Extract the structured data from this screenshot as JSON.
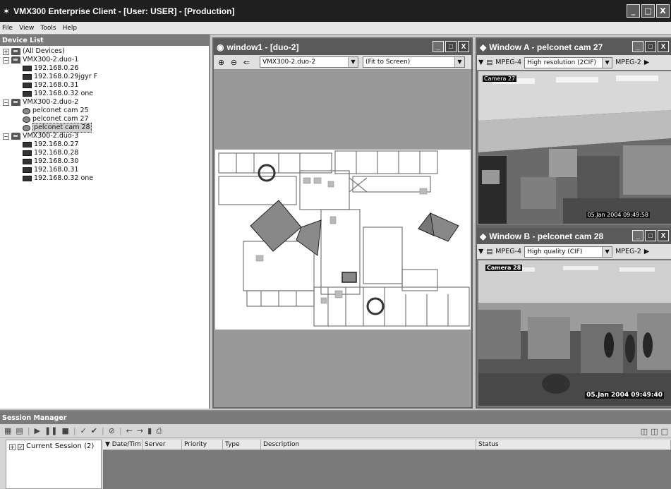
{
  "app": {
    "title": "VMX300 Enterprise Client - [User: USER] - [Production]",
    "window_buttons": [
      "_",
      "□",
      "X"
    ]
  },
  "menu": [
    "File",
    "View",
    "Tools",
    "Help"
  ],
  "device_list": {
    "header": "Device List",
    "items": [
      {
        "label": "(All Devices)",
        "level": 0,
        "icon": "server-icon",
        "expander": "+"
      },
      {
        "label": "VMX300-2.duo-1",
        "level": 0,
        "icon": "server-icon",
        "expander": "−"
      },
      {
        "label": "192.168.0.26",
        "level": 1,
        "icon": "monitor-icon"
      },
      {
        "label": "192.168.0.29jgyr F",
        "level": 1,
        "icon": "monitor-icon"
      },
      {
        "label": "192.168.0.31",
        "level": 1,
        "icon": "monitor-icon"
      },
      {
        "label": "192.168.0.32  one",
        "level": 1,
        "icon": "monitor-icon"
      },
      {
        "label": "VMX300-2.duo-2",
        "level": 0,
        "icon": "server-icon",
        "expander": "−"
      },
      {
        "label": "pelconet cam 25",
        "level": 1,
        "icon": "camera-icon"
      },
      {
        "label": "pelconet cam 27",
        "level": 1,
        "icon": "camera-icon"
      },
      {
        "label": "pelconet cam 28",
        "level": 1,
        "icon": "camera-icon",
        "selected": true
      },
      {
        "label": "VMX300-2.duo-3",
        "level": 0,
        "icon": "server-icon",
        "expander": "−"
      },
      {
        "label": "192.168.0.27",
        "level": 1,
        "icon": "monitor-icon"
      },
      {
        "label": "192.168.0.28",
        "level": 1,
        "icon": "monitor-icon"
      },
      {
        "label": "192.168.0.30",
        "level": 1,
        "icon": "monitor-icon"
      },
      {
        "label": "192.168.0.31",
        "level": 1,
        "icon": "monitor-icon"
      },
      {
        "label": "192.168.0.32  one",
        "level": 1,
        "icon": "monitor-icon"
      }
    ]
  },
  "map_window": {
    "title": "window1 - [duo-2]",
    "server_select": "VMX300-2.duo-2",
    "zoom_select": "(Fit to Screen)"
  },
  "camera_a": {
    "title": "Window A - pelconet cam 27",
    "codec": "MPEG-4",
    "quality": "High resolution (2CIF)",
    "codec2": "MPEG-2",
    "overlay_name": "Camera 27",
    "overlay_time": "05.Jan 2004  09:49:58"
  },
  "camera_b": {
    "title": "Window B - pelconet cam 28",
    "codec": "MPEG-4",
    "quality": "High quality (CIF)",
    "codec2": "MPEG-2",
    "overlay_name": "Camera 28",
    "overlay_time": "05.Jan 2004  09:49:40"
  },
  "session": {
    "header": "Session Manager",
    "tree_item": "Current Session (2)",
    "columns": [
      "Date/Tim",
      "Server",
      "Priority",
      "Type",
      "Description",
      "Status"
    ]
  }
}
